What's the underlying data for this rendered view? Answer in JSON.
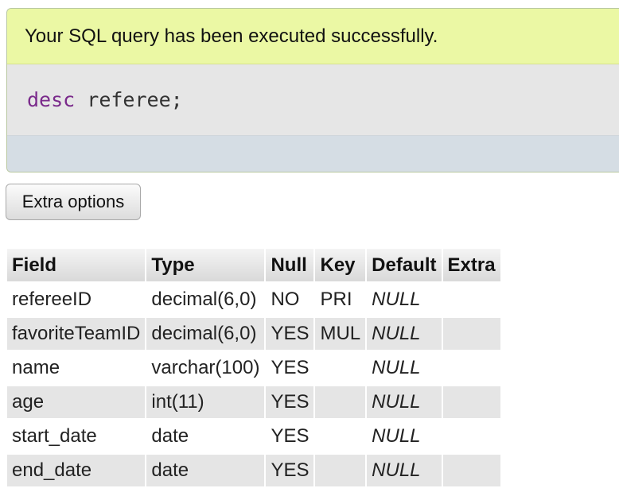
{
  "status": {
    "message": "Your SQL query has been executed successfully."
  },
  "query": {
    "keyword": "desc",
    "rest": " referee;"
  },
  "buttons": {
    "extra_options": "Extra options"
  },
  "table": {
    "headers": [
      "Field",
      "Type",
      "Null",
      "Key",
      "Default",
      "Extra"
    ],
    "rows": [
      [
        "refereeID",
        "decimal(6,0)",
        "NO",
        "PRI",
        "NULL",
        ""
      ],
      [
        "favoriteTeamID",
        "decimal(6,0)",
        "YES",
        "MUL",
        "NULL",
        ""
      ],
      [
        "name",
        "varchar(100)",
        "YES",
        "",
        "NULL",
        ""
      ],
      [
        "age",
        "int(11)",
        "YES",
        "",
        "NULL",
        ""
      ],
      [
        "start_date",
        "date",
        "YES",
        "",
        "NULL",
        ""
      ],
      [
        "end_date",
        "date",
        "YES",
        "",
        "NULL",
        ""
      ]
    ]
  },
  "colors": {
    "success_bg": "#ebf8a4",
    "sql_keyword": "#7a2a8b",
    "row_alt": "#e5e5e5",
    "null_text": "#888888"
  }
}
